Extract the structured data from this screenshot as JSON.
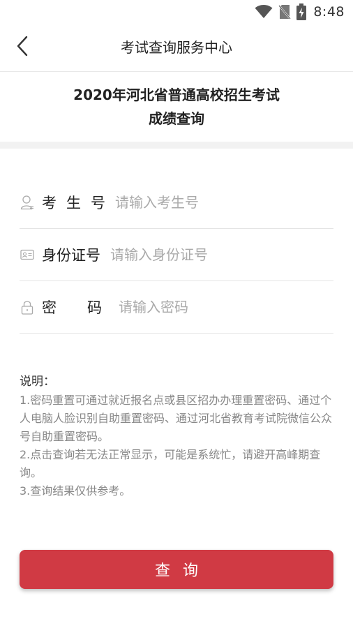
{
  "status_bar": {
    "time": "8:48",
    "icons": [
      "wifi-icon",
      "no-sim-icon",
      "battery-charging-icon"
    ]
  },
  "nav": {
    "back_icon": "chevron-left-icon",
    "title": "考试查询服务中心"
  },
  "exam": {
    "title": "2020年河北省普通高校招生考试",
    "subtitle": "成绩查询"
  },
  "form": {
    "fields": [
      {
        "icon": "user-icon",
        "label": "考生号",
        "placeholder": "请输入考生号",
        "value": ""
      },
      {
        "icon": "id-card-icon",
        "label": "身份证号",
        "placeholder": "请输入身份证号",
        "value": ""
      },
      {
        "icon": "lock-icon",
        "label": "密码",
        "placeholder": "请输入密码",
        "value": ""
      }
    ]
  },
  "notes": {
    "title": "说明：",
    "items": [
      "1.密码重置可通过就近报名点或县区招办办理重置密码、通过个人电脑人脸识别自助重置密码、通过河北省教育考试院微信公众号自助重置密码。",
      "2.点击查询若无法正常显示，可能是系统忙，请避开高峰期查询。",
      "3.查询结果仅供参考。"
    ]
  },
  "submit": {
    "label": "查询"
  },
  "colors": {
    "accent": "#d03a44",
    "placeholder": "#aaaaaa",
    "note_text": "#888888",
    "divider": "#e4e4e4"
  }
}
